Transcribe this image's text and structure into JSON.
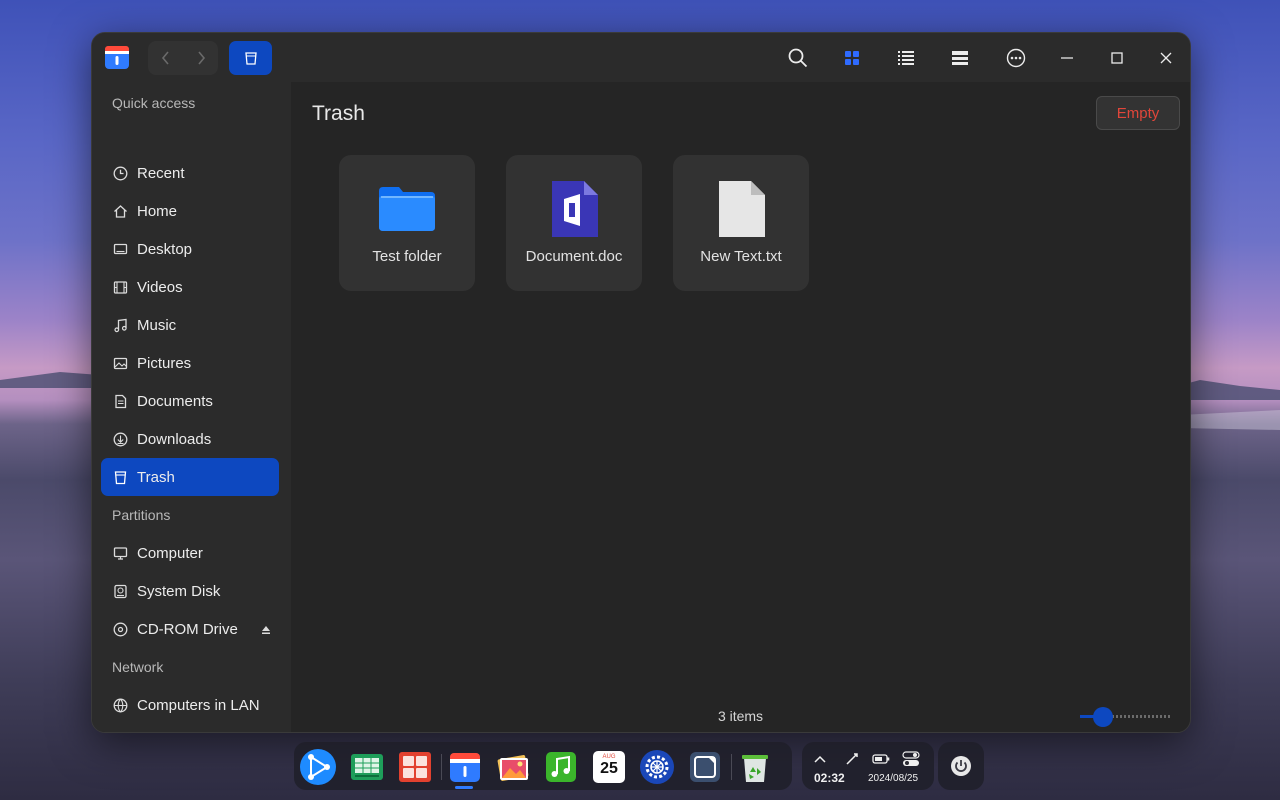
{
  "window": {
    "title": "Trash",
    "empty_button": "Empty",
    "status": "3 items",
    "zoom_level": 0.25
  },
  "toolbar": {
    "icons": [
      "back-icon",
      "forward-icon",
      "trash-icon",
      "search-icon",
      "grid-view-icon",
      "list-view-icon",
      "detail-view-icon",
      "more-icon",
      "minimize-icon",
      "maximize-icon",
      "close-icon"
    ]
  },
  "sidebar": {
    "quick_access_label": "Quick access",
    "quick_access": [
      {
        "label": "Recent",
        "icon": "clock-icon"
      },
      {
        "label": "Home",
        "icon": "home-icon"
      },
      {
        "label": "Desktop",
        "icon": "desktop-icon"
      },
      {
        "label": "Videos",
        "icon": "video-icon"
      },
      {
        "label": "Music",
        "icon": "music-icon"
      },
      {
        "label": "Pictures",
        "icon": "picture-icon"
      },
      {
        "label": "Documents",
        "icon": "document-icon"
      },
      {
        "label": "Downloads",
        "icon": "download-icon"
      },
      {
        "label": "Trash",
        "icon": "trash-icon",
        "active": true
      }
    ],
    "partitions_label": "Partitions",
    "partitions": [
      {
        "label": "Computer",
        "icon": "computer-icon"
      },
      {
        "label": "System Disk",
        "icon": "disk-icon"
      },
      {
        "label": "CD-ROM Drive",
        "icon": "cdrom-icon"
      }
    ],
    "network_label": "Network",
    "network": [
      {
        "label": "Computers in LAN",
        "icon": "network-icon"
      }
    ]
  },
  "files": [
    {
      "name": "Test folder",
      "icon": "folder-icon"
    },
    {
      "name": "Document.doc",
      "icon": "doc-icon"
    },
    {
      "name": "New Text.txt",
      "icon": "txt-icon"
    }
  ],
  "dock": {
    "apps": [
      "launcher",
      "spreadsheet",
      "office",
      "file-manager",
      "image-viewer",
      "music",
      "calendar",
      "settings",
      "notes",
      "trash"
    ],
    "calendar_month": "AUG",
    "calendar_day": "25"
  },
  "tray": {
    "time": "02:32",
    "date": "2024/08/25"
  },
  "colors": {
    "accent": "#0d48c0",
    "danger": "#e0463a",
    "window_bg": "#252525"
  }
}
